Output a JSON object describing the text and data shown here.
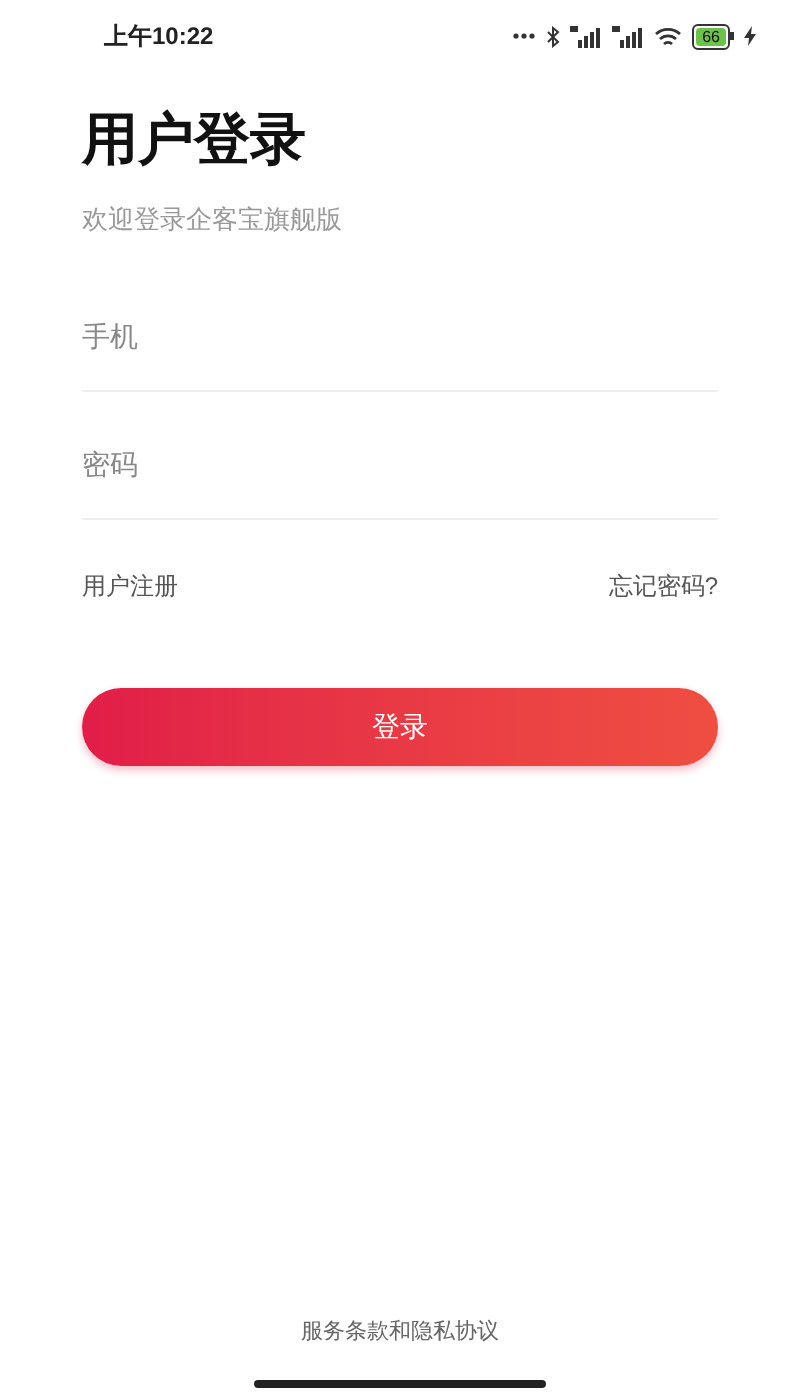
{
  "status_bar": {
    "time": "上午10:22",
    "battery": "66",
    "charging": true
  },
  "title": "用户登录",
  "subtitle": "欢迎登录企客宝旗舰版",
  "fields": [
    {
      "placeholder": "手机"
    },
    {
      "placeholder": "密码"
    }
  ],
  "links": [
    "用户注册",
    "忘记密码?"
  ],
  "login_button": "登录",
  "footer": "服务条款和隐私协议"
}
